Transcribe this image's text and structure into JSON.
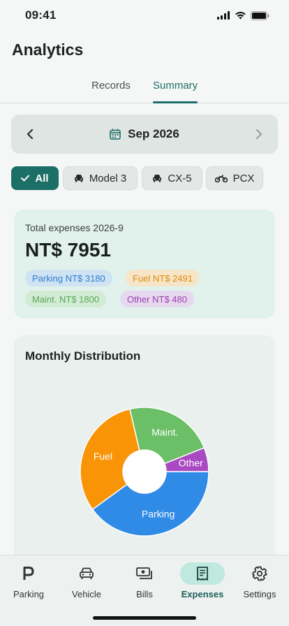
{
  "status_bar": {
    "time": "09:41"
  },
  "header": {
    "title": "Analytics"
  },
  "tabs": [
    {
      "label": "Records",
      "active": false
    },
    {
      "label": "Summary",
      "active": true
    }
  ],
  "month_selector": {
    "label": "Sep 2026",
    "icon": "calendar-icon"
  },
  "filters": [
    {
      "label": "All",
      "icon": "check-icon",
      "active": true
    },
    {
      "label": "Model 3",
      "icon": "car-icon",
      "active": false
    },
    {
      "label": "CX-5",
      "icon": "car-icon",
      "active": false
    },
    {
      "label": "PCX",
      "icon": "motorcycle-icon",
      "active": false
    }
  ],
  "summary": {
    "label": "Total expenses 2026-9",
    "total": "NT$ 7951",
    "tags": [
      {
        "text": "Parking NT$ 3180",
        "color": "#2e7fd0",
        "bg": "#cfe3f3"
      },
      {
        "text": "Fuel NT$ 2491",
        "color": "#e08a10",
        "bg": "#f6e5c6"
      },
      {
        "text": "Maint. NT$ 1800",
        "color": "#5ba857",
        "bg": "#d2ebd5"
      },
      {
        "text": "Other NT$ 480",
        "color": "#9b3fb3",
        "bg": "#e6d8ee"
      }
    ]
  },
  "chart": {
    "title": "Monthly Distribution",
    "chart_data": {
      "type": "pie",
      "categories": [
        "Parking",
        "Fuel",
        "Maint.",
        "Other"
      ],
      "values": [
        3180,
        2491,
        1800,
        480
      ],
      "colors": [
        "#2f8be6",
        "#f89406",
        "#6bbf67",
        "#a94ac2"
      ],
      "donut": true
    }
  },
  "bottom_nav": [
    {
      "label": "Parking",
      "icon": "parking-icon",
      "active": false
    },
    {
      "label": "Vehicle",
      "icon": "car-icon",
      "active": false
    },
    {
      "label": "Bills",
      "icon": "bills-icon",
      "active": false
    },
    {
      "label": "Expenses",
      "icon": "receipt-icon",
      "active": true
    },
    {
      "label": "Settings",
      "icon": "gear-icon",
      "active": false
    }
  ],
  "colors": {
    "accent": "#1c6f66",
    "background": "#f4f7f6"
  }
}
